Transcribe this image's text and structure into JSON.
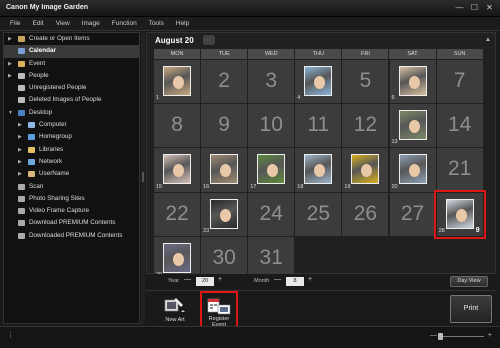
{
  "window": {
    "title": "Canon My Image Garden",
    "controls": [
      "—",
      "☐",
      "✕"
    ]
  },
  "menu": [
    "File",
    "Edit",
    "View",
    "Image",
    "Function",
    "Tools",
    "Help"
  ],
  "sidebar": [
    {
      "label": "Create or Open Items",
      "arrow": "▶",
      "color": "#c8a45c",
      "indent": 0,
      "selected": false
    },
    {
      "label": "Calendar",
      "arrow": "",
      "color": "#7aa0d8",
      "indent": 0,
      "selected": true
    },
    {
      "label": "Event",
      "arrow": "▶",
      "color": "#d9b05a",
      "indent": 0,
      "selected": false
    },
    {
      "label": "People",
      "arrow": "▶",
      "color": "#bbbbbb",
      "indent": 0,
      "selected": false
    },
    {
      "label": "Unregistered People",
      "arrow": "",
      "color": "#bbbbbb",
      "indent": 0,
      "selected": false
    },
    {
      "label": "Deleted Images of People",
      "arrow": "",
      "color": "#bbbbbb",
      "indent": 0,
      "selected": false
    },
    {
      "label": "Desktop",
      "arrow": "▼",
      "color": "#4a7fc1",
      "indent": 0,
      "selected": false
    },
    {
      "label": "Computer",
      "arrow": "▶",
      "color": "#8fb6e0",
      "indent": 1,
      "selected": false
    },
    {
      "label": "Homegroup",
      "arrow": "▶",
      "color": "#5aa0e0",
      "indent": 1,
      "selected": false
    },
    {
      "label": "Libraries",
      "arrow": "▶",
      "color": "#e0c060",
      "indent": 1,
      "selected": false
    },
    {
      "label": "Network",
      "arrow": "▶",
      "color": "#6fa8dc",
      "indent": 1,
      "selected": false
    },
    {
      "label": "UserName",
      "arrow": "▶",
      "color": "#d9b77a",
      "indent": 1,
      "selected": false
    },
    {
      "label": "Scan",
      "arrow": "",
      "color": "#aaaaaa",
      "indent": 0,
      "selected": false
    },
    {
      "label": "Photo Sharing Sites",
      "arrow": "",
      "color": "#aaaaaa",
      "indent": 0,
      "selected": false
    },
    {
      "label": "Video Frame Capture",
      "arrow": "",
      "color": "#aaaaaa",
      "indent": 0,
      "selected": false
    },
    {
      "label": "Download PREMIUM Contents",
      "arrow": "",
      "color": "#aaaaaa",
      "indent": 0,
      "selected": false
    },
    {
      "label": "Downloaded PREMIUM Contents",
      "arrow": "",
      "color": "#aaaaaa",
      "indent": 0,
      "selected": false
    }
  ],
  "calendar": {
    "month_label": "August 20",
    "days": [
      "MON",
      "TUE",
      "WED",
      "THU",
      "FRI",
      "SAT",
      "SUN"
    ],
    "cells": [
      {
        "day": 1,
        "photo": true,
        "bg": "#c9a880"
      },
      {
        "day": 2,
        "photo": false
      },
      {
        "day": 3,
        "photo": false
      },
      {
        "day": 4,
        "photo": true,
        "bg": "#8ab4d8"
      },
      {
        "day": 5,
        "photo": false
      },
      {
        "day": 6,
        "photo": true,
        "bg": "#d8c0a0"
      },
      {
        "day": 7,
        "photo": false
      },
      {
        "day": 8,
        "photo": false
      },
      {
        "day": 9,
        "photo": false
      },
      {
        "day": 10,
        "photo": false
      },
      {
        "day": 11,
        "photo": false
      },
      {
        "day": 12,
        "photo": false
      },
      {
        "day": 13,
        "photo": true,
        "bg": "#7c8a6a"
      },
      {
        "day": 14,
        "photo": false
      },
      {
        "day": 15,
        "photo": true,
        "bg": "#d6c0b8"
      },
      {
        "day": 16,
        "photo": true,
        "bg": "#a08c70"
      },
      {
        "day": 17,
        "photo": true,
        "bg": "#5e8a3c"
      },
      {
        "day": 18,
        "photo": true,
        "bg": "#9cb4c8"
      },
      {
        "day": 19,
        "photo": true,
        "bg": "#d8b020"
      },
      {
        "day": 20,
        "photo": true,
        "bg": "#8ea0b4"
      },
      {
        "day": 21,
        "photo": false
      },
      {
        "day": 22,
        "photo": false
      },
      {
        "day": 23,
        "photo": true,
        "bg": "#2a2a2a"
      },
      {
        "day": 24,
        "photo": false
      },
      {
        "day": 25,
        "photo": false
      },
      {
        "day": 26,
        "photo": false
      },
      {
        "day": 27,
        "photo": false
      },
      {
        "day": 28,
        "photo": true,
        "bg": "#d0d8e0",
        "count": "9",
        "highlight": true
      },
      {
        "day": 29,
        "photo": true,
        "bg": "#6a6a8a"
      },
      {
        "day": 30,
        "photo": false
      },
      {
        "day": 31,
        "photo": false
      }
    ]
  },
  "dateslot": {
    "year_label": "Year",
    "year_value": "20",
    "month_label": "Month",
    "month_value": "8",
    "minus": "—",
    "plus": "+",
    "day_view": "Day View"
  },
  "bottom": {
    "new_art": "New Art",
    "register_line1": "Register",
    "register_line2": "Event",
    "print": "Print"
  },
  "status": {
    "dots": "⋮",
    "zoom_minus": "—",
    "zoom_plus": "+"
  }
}
